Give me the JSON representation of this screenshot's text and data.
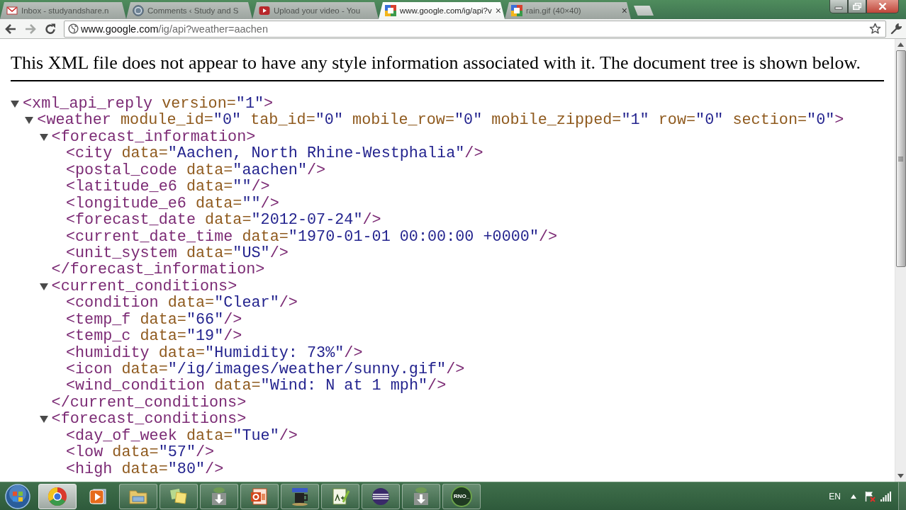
{
  "browser": {
    "tabs": [
      {
        "kind": "envelope",
        "title": "Inbox - studyandshare.n",
        "selected": false
      },
      {
        "kind": "circle",
        "title": "Comments ‹ Study and S",
        "selected": false
      },
      {
        "kind": "video",
        "title": "Upload your video - You",
        "selected": false
      },
      {
        "kind": "squares",
        "title": "www.google.com/ig/api?v",
        "close": "×",
        "selected": true
      },
      {
        "kind": "squares",
        "title": "rain.gif (40×40)",
        "close": "×",
        "selected": false
      }
    ],
    "address_bar": {
      "host": "www.google.com",
      "path": "/ig/api?weather=aachen"
    }
  },
  "page": {
    "notice": "This XML file does not appear to have any style information associated with it. The document tree is shown below.",
    "tree": {
      "tag": "<xml_api_reply",
      "attributes": [
        {
          "name": " version=",
          "value": "\"1\""
        }
      ],
      "end": ">",
      "expanded": true,
      "children": [
        {
          "tag": "<weather",
          "attributes": [
            {
              "name": " module_id=",
              "value": "\"0\""
            },
            {
              "name": " tab_id=",
              "value": "\"0\""
            },
            {
              "name": " mobile_row=",
              "value": "\"0\""
            },
            {
              "name": " mobile_zipped=",
              "value": "\"1\""
            },
            {
              "name": " row=",
              "value": "\"0\""
            },
            {
              "name": " section=",
              "value": "\"0\""
            }
          ],
          "end": ">",
          "expanded": true,
          "children": [
            {
              "tag": "<forecast_information",
              "end": ">",
              "expanded": true,
              "children": [
                {
                  "tag": "<city",
                  "attributes": [
                    {
                      "name": " data=",
                      "value": "\"Aachen, North Rhine-Westphalia\""
                    }
                  ],
                  "end": "/>"
                },
                {
                  "tag": "<postal_code",
                  "attributes": [
                    {
                      "name": " data=",
                      "value": "\"aachen\""
                    }
                  ],
                  "end": "/>"
                },
                {
                  "tag": "<latitude_e6",
                  "attributes": [
                    {
                      "name": " data=",
                      "value": "\"\""
                    }
                  ],
                  "end": "/>"
                },
                {
                  "tag": "<longitude_e6",
                  "attributes": [
                    {
                      "name": " data=",
                      "value": "\"\""
                    }
                  ],
                  "end": "/>"
                },
                {
                  "tag": "<forecast_date",
                  "attributes": [
                    {
                      "name": " data=",
                      "value": "\"2012-07-24\""
                    }
                  ],
                  "end": "/>"
                },
                {
                  "tag": "<current_date_time",
                  "attributes": [
                    {
                      "name": " data=",
                      "value": "\"1970-01-01 00:00:00 +0000\""
                    }
                  ],
                  "end": "/>"
                },
                {
                  "tag": "<unit_system",
                  "attributes": [
                    {
                      "name": " data=",
                      "value": "\"US\""
                    }
                  ],
                  "end": "/>"
                }
              ],
              "close": "</forecast_information>"
            },
            {
              "tag": "<current_conditions",
              "end": ">",
              "expanded": true,
              "children": [
                {
                  "tag": "<condition",
                  "attributes": [
                    {
                      "name": " data=",
                      "value": "\"Clear\""
                    }
                  ],
                  "end": "/>"
                },
                {
                  "tag": "<temp_f",
                  "attributes": [
                    {
                      "name": " data=",
                      "value": "\"66\""
                    }
                  ],
                  "end": "/>"
                },
                {
                  "tag": "<temp_c",
                  "attributes": [
                    {
                      "name": " data=",
                      "value": "\"19\""
                    }
                  ],
                  "end": "/>"
                },
                {
                  "tag": "<humidity",
                  "attributes": [
                    {
                      "name": " data=",
                      "value": "\"Humidity: 73%\""
                    }
                  ],
                  "end": "/>"
                },
                {
                  "tag": "<icon",
                  "attributes": [
                    {
                      "name": " data=",
                      "value": "\"/ig/images/weather/sunny.gif\""
                    }
                  ],
                  "end": "/>"
                },
                {
                  "tag": "<wind_condition",
                  "attributes": [
                    {
                      "name": " data=",
                      "value": "\"Wind: N at 1 mph\""
                    }
                  ],
                  "end": "/>"
                }
              ],
              "close": "</current_conditions>"
            },
            {
              "tag": "<forecast_conditions",
              "end": ">",
              "expanded": true,
              "children": [
                {
                  "tag": "<day_of_week",
                  "attributes": [
                    {
                      "name": " data=",
                      "value": "\"Tue\""
                    }
                  ],
                  "end": "/>"
                },
                {
                  "tag": "<low",
                  "attributes": [
                    {
                      "name": " data=",
                      "value": "\"57\""
                    }
                  ],
                  "end": "/>"
                },
                {
                  "tag": "<high",
                  "attributes": [
                    {
                      "name": " data=",
                      "value": "\"80\""
                    }
                  ],
                  "end": "/>"
                }
              ]
            }
          ]
        }
      ]
    }
  },
  "taskbar": {
    "buttons": [
      {
        "kind": "round-logo",
        "running": true,
        "selected": true
      },
      {
        "kind": "player",
        "running": false,
        "selected": false
      },
      {
        "kind": "folder",
        "running": true,
        "selected": false
      },
      {
        "kind": "notes",
        "running": true,
        "selected": false
      },
      {
        "kind": "download",
        "running": true,
        "selected": false
      },
      {
        "kind": "slides",
        "running": true,
        "selected": false
      },
      {
        "kind": "mug",
        "running": true,
        "selected": false
      },
      {
        "kind": "notepad",
        "running": true,
        "selected": false
      },
      {
        "kind": "sphere",
        "running": true,
        "selected": false
      },
      {
        "kind": "download",
        "running": true,
        "selected": false
      },
      {
        "kind": "badge",
        "label": "RNO_",
        "running": true,
        "selected": false
      }
    ],
    "language": "EN"
  }
}
